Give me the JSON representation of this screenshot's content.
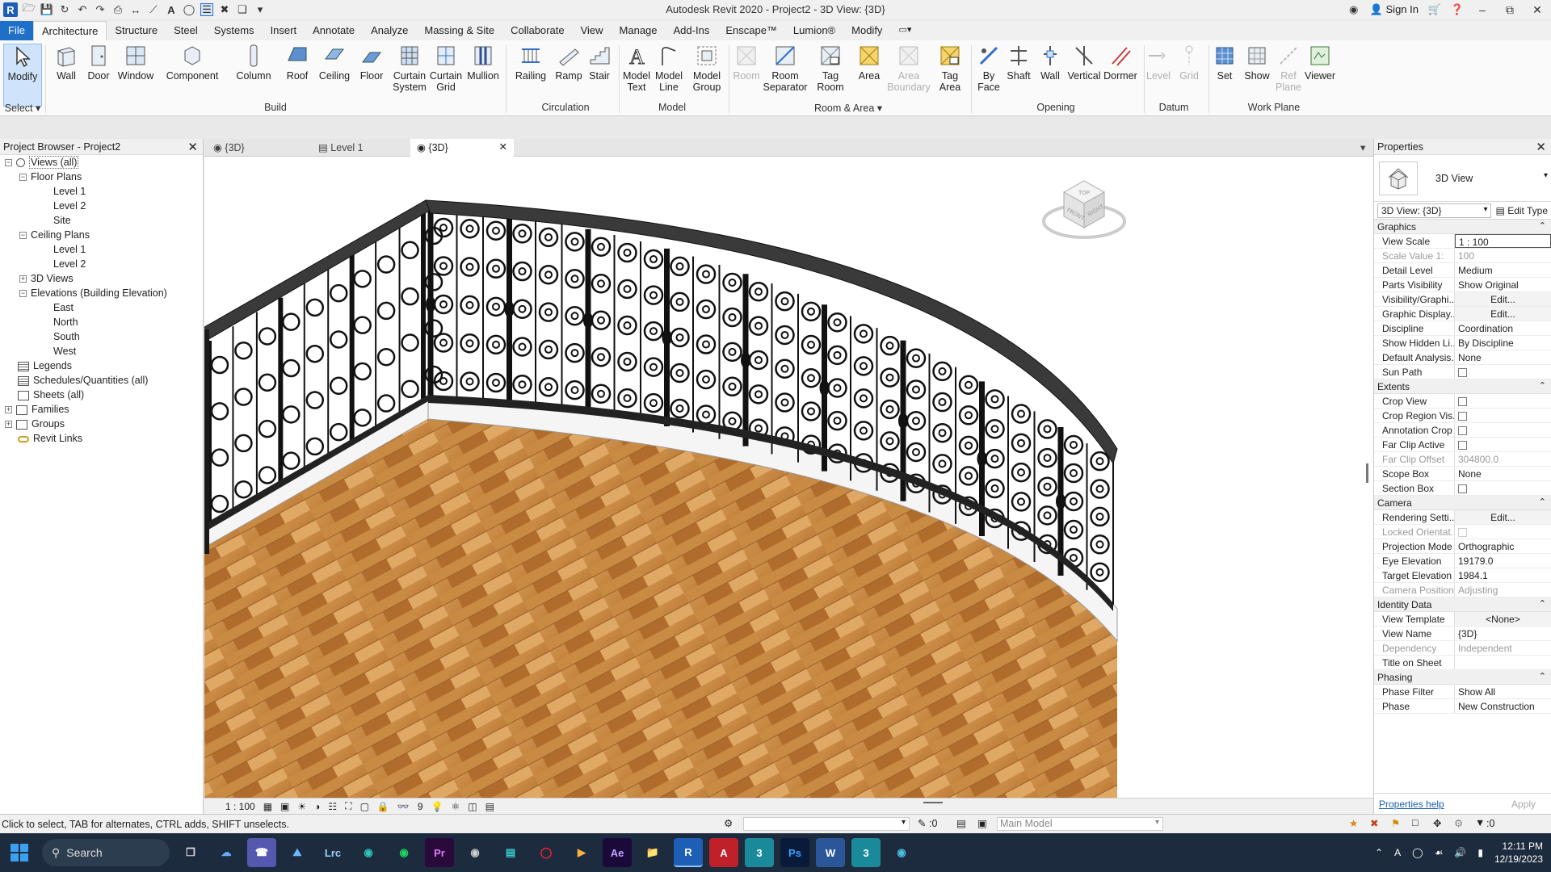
{
  "titlebar": {
    "window_title": "Autodesk Revit 2020 - Project2 - 3D View: {3D}",
    "sign_in": "Sign In"
  },
  "ribbon_tabs": [
    "File",
    "Architecture",
    "Structure",
    "Steel",
    "Systems",
    "Insert",
    "Annotate",
    "Analyze",
    "Massing & Site",
    "Collaborate",
    "View",
    "Manage",
    "Add-Ins",
    "Enscape™",
    "Lumion®",
    "Modify"
  ],
  "ribbon": {
    "select": {
      "modify": "Modify",
      "group": "Select"
    },
    "build": {
      "wall": "Wall",
      "door": "Door",
      "window": "Window",
      "component": "Component",
      "column": "Column",
      "roof": "Roof",
      "ceiling": "Ceiling",
      "floor": "Floor",
      "curtain_system_1": "Curtain",
      "curtain_system_2": "System",
      "curtain_grid_1": "Curtain",
      "curtain_grid_2": "Grid",
      "mullion": "Mullion",
      "group": "Build"
    },
    "circulation": {
      "railing": "Railing",
      "ramp": "Ramp",
      "stair": "Stair",
      "group": "Circulation"
    },
    "model": {
      "model_text_1": "Model",
      "model_text_2": "Text",
      "model_line_1": "Model",
      "model_line_2": "Line",
      "model_group_1": "Model",
      "model_group_2": "Group",
      "group": "Model"
    },
    "room_area": {
      "room": "Room",
      "room_sep_1": "Room",
      "room_sep_2": "Separator",
      "tag_room_1": "Tag",
      "tag_room_2": "Room",
      "area": "Area",
      "area_boundary_1": "Area",
      "area_boundary_2": "Boundary",
      "tag_area_1": "Tag",
      "tag_area_2": "Area",
      "group": "Room & Area"
    },
    "opening": {
      "by_face_1": "By",
      "by_face_2": "Face",
      "shaft": "Shaft",
      "wall": "Wall",
      "vertical": "Vertical",
      "dormer": "Dormer",
      "group": "Opening"
    },
    "datum": {
      "level": "Level",
      "grid": "Grid",
      "group": "Datum"
    },
    "work_plane": {
      "set": "Set",
      "show": "Show",
      "ref_plane_1": "Ref",
      "ref_plane_2": "Plane",
      "viewer": "Viewer",
      "group": "Work Plane"
    }
  },
  "project_browser": {
    "title": "Project Browser - Project2",
    "nodes": {
      "views_all": "Views (all)",
      "floor_plans": "Floor Plans",
      "fp_level1": "Level 1",
      "fp_level2": "Level 2",
      "fp_site": "Site",
      "ceiling_plans": "Ceiling Plans",
      "cp_level1": "Level 1",
      "cp_level2": "Level 2",
      "views_3d": "3D Views",
      "elevations": "Elevations (Building Elevation)",
      "el_east": "East",
      "el_north": "North",
      "el_south": "South",
      "el_west": "West",
      "legends": "Legends",
      "schedules": "Schedules/Quantities (all)",
      "sheets": "Sheets (all)",
      "families": "Families",
      "groups": "Groups",
      "revit_links": "Revit Links"
    }
  },
  "view_tabs": [
    "{3D}",
    "Level 1",
    "{3D}"
  ],
  "viewcube": {
    "top": "TOP",
    "front": "FRONT",
    "right": "RIGHT"
  },
  "view_bar": {
    "scale": "1 : 100",
    "hidden_count": "9"
  },
  "properties": {
    "title": "Properties",
    "type_name": "3D View",
    "instance": "3D View: {3D}",
    "edit_type": "Edit Type",
    "categories": {
      "graphics": "Graphics",
      "extents": "Extents",
      "camera": "Camera",
      "identity": "Identity Data",
      "phasing": "Phasing"
    },
    "rows": {
      "view_scale": {
        "label": "View Scale",
        "value": "1 : 100"
      },
      "scale_value": {
        "label": "Scale Value",
        "prefix": "1:",
        "value": "100"
      },
      "detail_level": {
        "label": "Detail Level",
        "value": "Medium"
      },
      "parts_visibility": {
        "label": "Parts Visibility",
        "value": "Show Original"
      },
      "vis_graphics": {
        "label": "Visibility/Graphi...",
        "value": "Edit..."
      },
      "graphic_display": {
        "label": "Graphic Display...",
        "value": "Edit..."
      },
      "discipline": {
        "label": "Discipline",
        "value": "Coordination"
      },
      "show_hidden": {
        "label": "Show Hidden Li...",
        "value": "By Discipline"
      },
      "default_analysis": {
        "label": "Default Analysis...",
        "value": "None"
      },
      "sun_path": {
        "label": "Sun Path"
      },
      "crop_view": {
        "label": "Crop View"
      },
      "crop_region": {
        "label": "Crop Region Vis..."
      },
      "annotation_crop": {
        "label": "Annotation Crop"
      },
      "far_clip_active": {
        "label": "Far Clip Active"
      },
      "far_clip_offset": {
        "label": "Far Clip Offset",
        "value": "304800.0"
      },
      "scope_box": {
        "label": "Scope Box",
        "value": "None"
      },
      "section_box": {
        "label": "Section Box"
      },
      "rendering": {
        "label": "Rendering Setti...",
        "value": "Edit..."
      },
      "locked_orient": {
        "label": "Locked Orientat..."
      },
      "projection": {
        "label": "Projection Mode",
        "value": "Orthographic"
      },
      "eye_elev": {
        "label": "Eye Elevation",
        "value": "19179.0"
      },
      "target_elev": {
        "label": "Target Elevation",
        "value": "1984.1"
      },
      "camera_pos": {
        "label": "Camera Position",
        "value": "Adjusting"
      },
      "view_template": {
        "label": "View Template",
        "value": "<None>"
      },
      "view_name": {
        "label": "View Name",
        "value": "{3D}"
      },
      "dependency": {
        "label": "Dependency",
        "value": "Independent"
      },
      "title_on_sheet": {
        "label": "Title on Sheet",
        "value": ""
      },
      "phase_filter": {
        "label": "Phase Filter",
        "value": "Show All"
      },
      "phase": {
        "label": "Phase",
        "value": "New Construction"
      }
    },
    "help": "Properties help",
    "apply": "Apply"
  },
  "status": {
    "hint": "Click to select, TAB for alternates, CTRL adds, SHIFT unselects.",
    "sel_count": ":0",
    "workset": "Main Model",
    "filter_count": ":0"
  },
  "taskbar": {
    "search": "Search",
    "time": "12:11 PM",
    "date": "12/19/2023",
    "apps": [
      "Lrc",
      "Pr",
      "Ae",
      "R",
      "Ps",
      "W"
    ]
  },
  "colors": {
    "accent": "#1e6fc8",
    "taskbar": "#1c2b3d",
    "floor": "#c4833f",
    "iron": "#1a1a1a"
  }
}
